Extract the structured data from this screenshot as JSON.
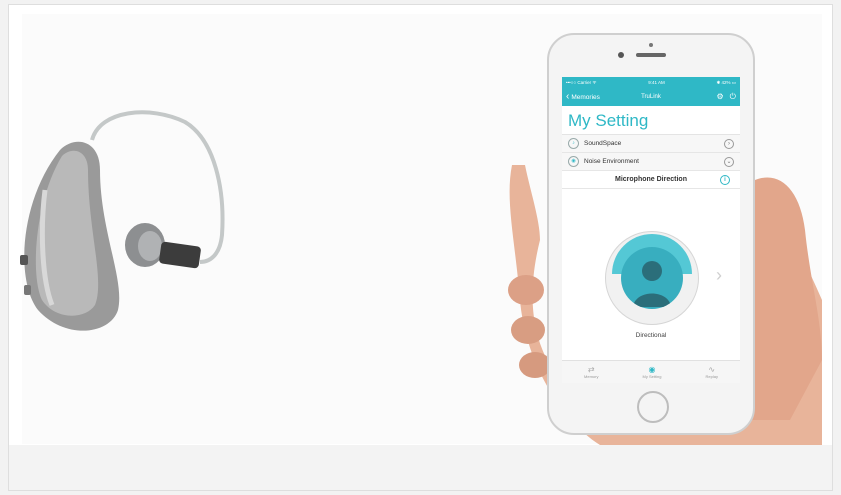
{
  "phone": {
    "status": {
      "carrier": "•••○○ Carrier ᯤ",
      "time": "9:41 AM",
      "battery": "✱ 42% ▭"
    },
    "nav": {
      "back_label": "Memories",
      "title": "TruLink"
    },
    "page_title": "My Setting",
    "rows": [
      {
        "label": "SoundSpace"
      },
      {
        "label": "Noise Environment"
      }
    ],
    "section_title": "Microphone Direction",
    "dial_label": "Directional",
    "tabs": [
      {
        "label": "Memory"
      },
      {
        "label": "My Setting"
      },
      {
        "label": "Replay"
      }
    ]
  },
  "colors": {
    "accent": "#2fb8c6",
    "hearing_aid_body": "#9a9a9a",
    "skin": "#e8b49a"
  }
}
